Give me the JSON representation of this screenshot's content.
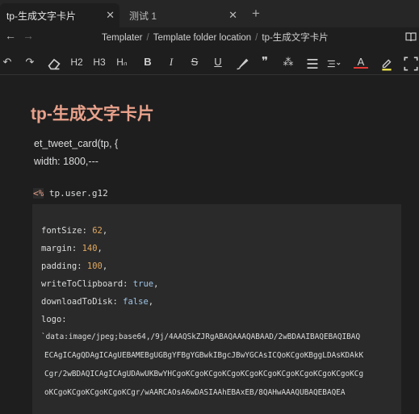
{
  "tabs": [
    {
      "label": "tp-生成文字卡片",
      "close": "✕",
      "active": true
    },
    {
      "label": "测试 1",
      "close": "✕",
      "active": false
    }
  ],
  "new_tab": "+",
  "breadcrumb": [
    "Templater",
    "Template folder location",
    "tp-生成文字卡片"
  ],
  "toolbar": {
    "h2": "H2",
    "h3": "H3",
    "hn": "Hₙ",
    "bold": "B",
    "italic": "I",
    "strike": "S",
    "underline": "U",
    "quote": "❞",
    "special": "⁂",
    "text_color": "A"
  },
  "editor": {
    "title": "tp-生成文字卡片",
    "line1": "et_tweet_card(tp, {",
    "line2": " width: 1800,---",
    "tp_tag": "<%",
    "tp_expr": " tp.user.g12",
    "code": [
      {
        "key": "fontSize: ",
        "val": "62",
        "type": "num",
        "end": ","
      },
      {
        "key": "margin: ",
        "val": "140",
        "type": "num",
        "end": ","
      },
      {
        "key": "padding: ",
        "val": "100",
        "type": "num",
        "end": ","
      },
      {
        "key": "writeToClipboard: ",
        "val": "true",
        "type": "bool",
        "end": ","
      },
      {
        "key": "downloadToDisk: ",
        "val": "false",
        "type": "bool",
        "end": ","
      },
      {
        "key": "logo:",
        "val": "",
        "type": "num",
        "end": ""
      }
    ],
    "base64": [
      " `data:image/jpeg;base64,/9j/4AAQSkZJRgABAQAAAQABAAD/2wBDAAIBAQEBAQIBAQ",
      "ECAgICAgQDAgICAgUEBAMEBgUGBgYFBgYGBwkIBgcJBwYGCAsICQoKCgoKBggLDAsKDAkK",
      "Cgr/2wBDAQICAgICAgUDAwUKBwYHCgoKCgoKCgoKCgoKCgoKCgoKCgoKCgoKCgoKCgoKCg",
      "oKCgoKCgoKCgoKCgoKCgr/wAARCAOsA6wDASIAAhEBAxEB/8QAHwAAAQUBAQEBAQEA"
    ]
  }
}
